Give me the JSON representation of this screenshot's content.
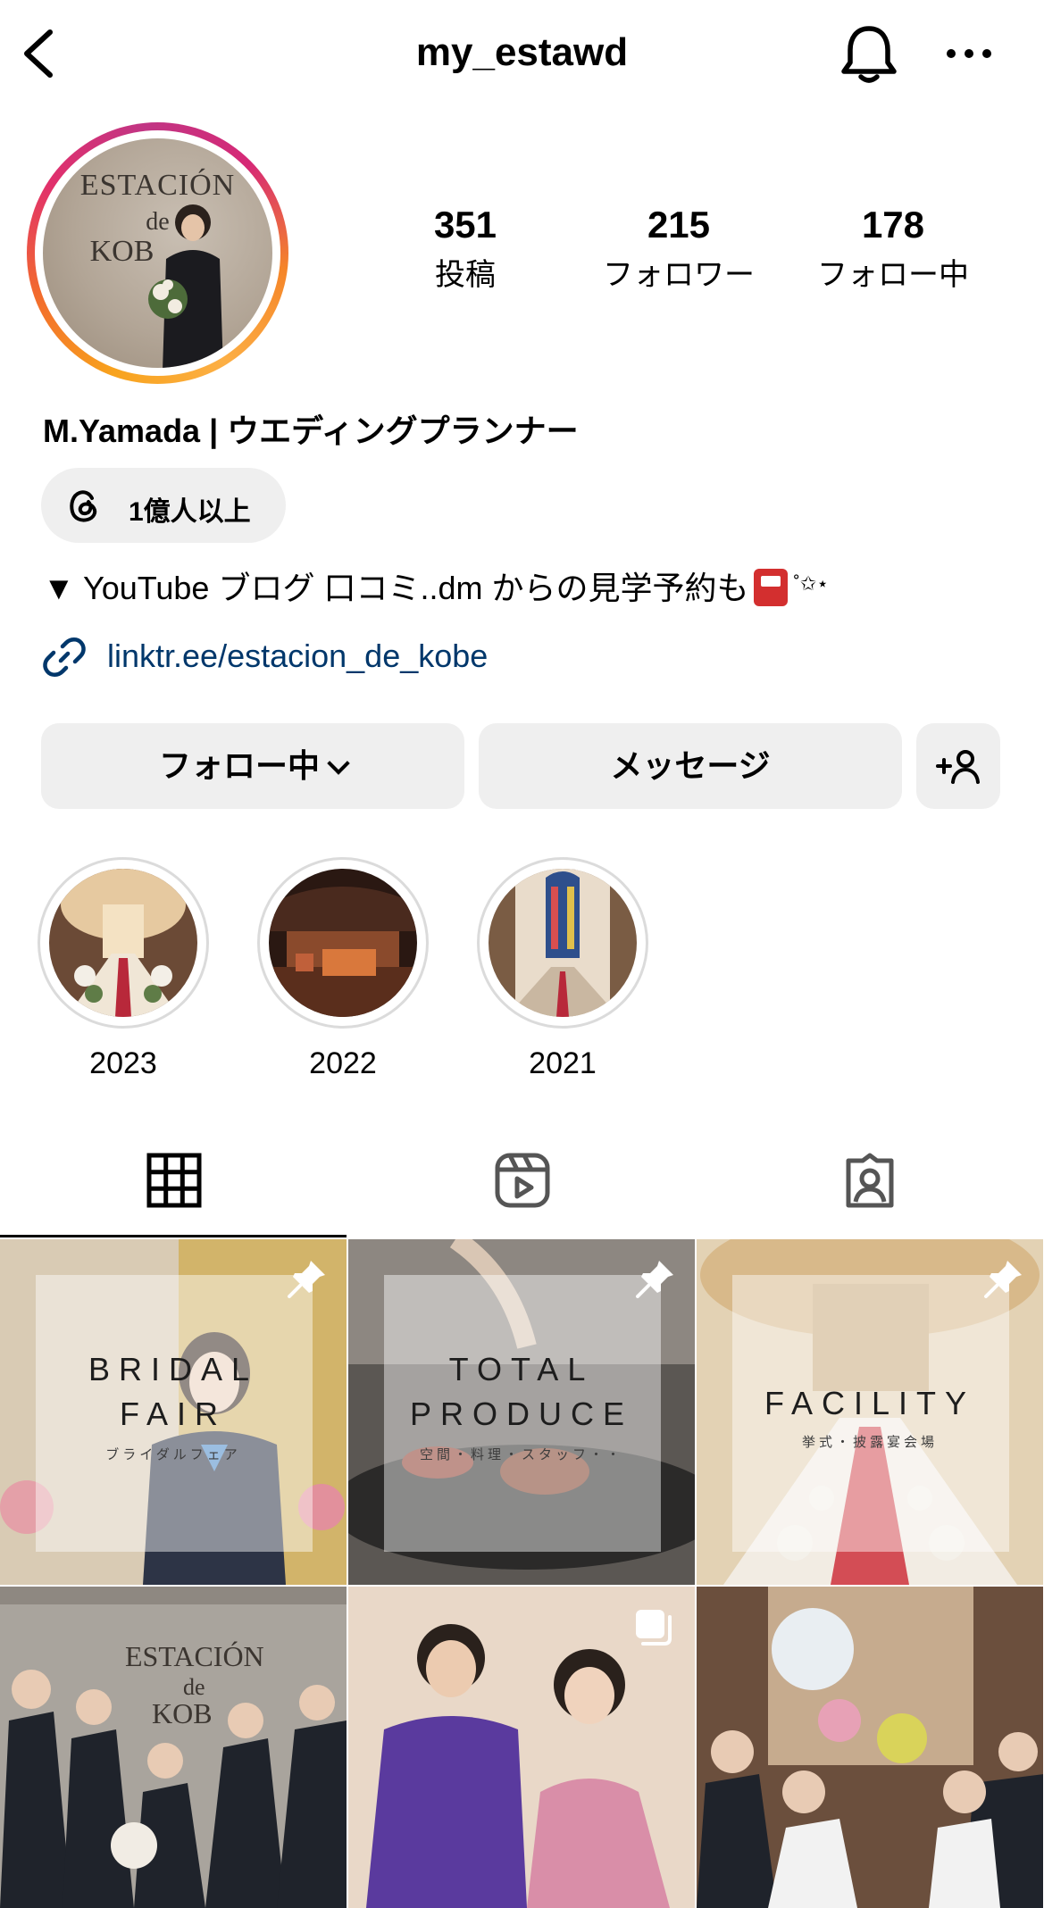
{
  "header": {
    "username": "my_estawd",
    "back_icon": "chevron-left-icon",
    "bell_icon": "bell-icon",
    "more_icon": "more-horizontal-icon"
  },
  "avatar": {
    "sign_line1": "ESTACIÓN",
    "sign_line2": "de",
    "sign_line3": "KOB"
  },
  "stats": [
    {
      "number": "351",
      "label": "投稿"
    },
    {
      "number": "215",
      "label": "フォロワー"
    },
    {
      "number": "178",
      "label": "フォロー中"
    }
  ],
  "profile": {
    "display_name": "M.Yamada | ウエディングプランナー",
    "threads_badge": "1億人以上",
    "bio": "▼ YouTube ブログ 口コミ..dm からの見学予約も",
    "bio_stars": "˚✩⋆",
    "link": "linktr.ee/estacion_de_kobe"
  },
  "buttons": {
    "following": "フォロー中",
    "message": "メッセージ"
  },
  "highlights": [
    {
      "label": "2023"
    },
    {
      "label": "2022"
    },
    {
      "label": "2021"
    }
  ],
  "tabs": [
    "grid-icon",
    "reels-icon",
    "tagged-icon"
  ],
  "posts": [
    {
      "title_line1": "BRIDAL",
      "title_line2": "FAIR",
      "subtitle": "ブライダルフェア",
      "pinned": true
    },
    {
      "title_line1": "TOTAL",
      "title_line2": "PRODUCE",
      "subtitle": "空間・料理・スタッフ・・",
      "pinned": true
    },
    {
      "title_line1": "FACILITY",
      "title_line2": "",
      "subtitle": "挙式・披露宴会場",
      "pinned": true
    },
    {
      "sign_line1": "ESTACIÓN",
      "sign_line2": "de",
      "sign_line3": "KOB"
    },
    {
      "multi": true
    },
    {}
  ],
  "colors": {
    "link": "#00376b",
    "button_bg": "#efefef",
    "story_ring_start": "#f8a31d",
    "story_ring_end": "#c13584"
  }
}
